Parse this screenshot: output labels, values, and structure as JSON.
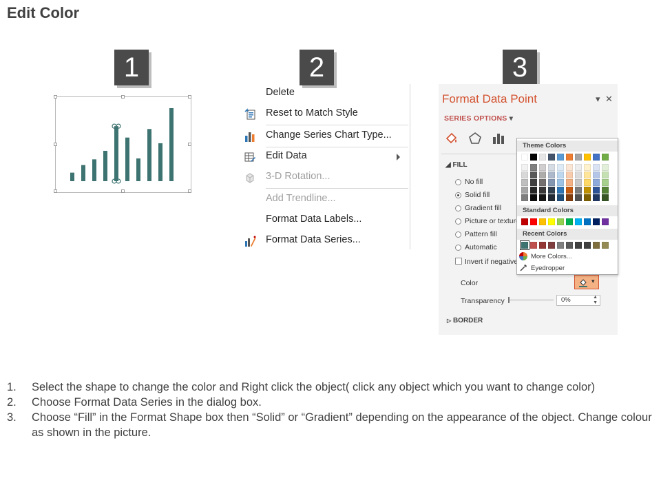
{
  "title": "Edit Color",
  "badges": [
    "1",
    "2",
    "3"
  ],
  "chart": {
    "values": [
      9,
      17,
      23,
      32,
      58,
      46,
      24,
      55,
      40,
      77
    ],
    "bar_color": "#3d7370",
    "selected_bar_index": 4
  },
  "context_menu": {
    "items": [
      {
        "label": "Delete",
        "icon": "",
        "disabled": false
      },
      {
        "label": "Reset to Match Style",
        "icon": "reset-style-icon",
        "disabled": false
      },
      {
        "label": "Change Series Chart Type...",
        "icon": "chart-type-icon",
        "disabled": false
      },
      {
        "label": "Edit Data",
        "icon": "edit-data-icon",
        "disabled": false,
        "submenu": true
      },
      {
        "label": "3-D Rotation...",
        "icon": "cube-icon",
        "disabled": true
      },
      {
        "label": "Add Trendline...",
        "icon": "",
        "disabled": true
      },
      {
        "label": "Format Data Labels...",
        "icon": "",
        "disabled": false
      },
      {
        "label": "Format Data Series...",
        "icon": "format-series-icon",
        "disabled": false
      }
    ]
  },
  "format_pane": {
    "title": "Format Data Point",
    "pin_glyph": "▾",
    "close_glyph": "✕",
    "series_options": "SERIES OPTIONS",
    "fill_header": "FILL",
    "fill_options": [
      "No fill",
      "Solid fill",
      "Gradient fill",
      "Picture or texture fill",
      "Pattern fill",
      "Automatic"
    ],
    "selected_fill": 1,
    "invert_label": "Invert if negative",
    "color_label": "Color",
    "transparency_label": "Transparency",
    "transparency_value": "0%",
    "border_header": "BORDER",
    "accent": "#d35230"
  },
  "color_picker": {
    "theme_header": "Theme Colors",
    "standard_header": "Standard Colors",
    "recent_header": "Recent Colors",
    "more_colors": "More Colors...",
    "eyedropper": "Eyedropper",
    "theme_top": [
      "#ffffff",
      "#000000",
      "#e7e6e6",
      "#44546a",
      "#5b9bd5",
      "#ed7d31",
      "#a5a5a5",
      "#ffc000",
      "#4472c4",
      "#70ad47"
    ],
    "theme_shades": [
      [
        "#f2f2f2",
        "#7f7f7f",
        "#d0cece",
        "#d6dce4",
        "#deebf6",
        "#fbe5d5",
        "#ededed",
        "#fff2cc",
        "#dae3f3",
        "#e2efd9"
      ],
      [
        "#d8d8d8",
        "#595959",
        "#aeabab",
        "#adb9ca",
        "#bdd7ee",
        "#f7cbac",
        "#dbdbdb",
        "#fee599",
        "#b4c6e7",
        "#c5e0b3"
      ],
      [
        "#bfbfbf",
        "#3f3f3f",
        "#757070",
        "#8496b0",
        "#9cc3e5",
        "#f4b183",
        "#c9c9c9",
        "#ffd965",
        "#8eaadb",
        "#a8d08d"
      ],
      [
        "#a5a5a5",
        "#262626",
        "#3a3838",
        "#323f4f",
        "#2e75b5",
        "#c55a11",
        "#7b7b7b",
        "#bf9000",
        "#2f5496",
        "#538135"
      ],
      [
        "#7f7f7f",
        "#0c0c0c",
        "#171616",
        "#222a35",
        "#1e4e79",
        "#833c0b",
        "#525252",
        "#7f6000",
        "#1f3864",
        "#375623"
      ]
    ],
    "standard": [
      "#c00000",
      "#ff0000",
      "#ffc000",
      "#ffff00",
      "#92d050",
      "#00b050",
      "#00b0f0",
      "#0070c0",
      "#002060",
      "#7030a0"
    ],
    "recent": [
      "#3d7370",
      "#c0504d",
      "#953735",
      "#7f3f3f",
      "#7f7f7f",
      "#595959",
      "#404040",
      "#3f3f3f",
      "#7f6f3f",
      "#948a54"
    ]
  },
  "instructions": [
    {
      "num": "1.",
      "text": "Select the shape to change the color and Right click the object( click any object which you want to change color)"
    },
    {
      "num": "2.",
      "text": "Choose Format Data Series in the dialog box."
    },
    {
      "num": "3.",
      "text": "Choose “Fill” in the Format Shape box then “Solid” or “Gradient” depending on the appearance of the object. Change colour as shown in the picture."
    }
  ]
}
